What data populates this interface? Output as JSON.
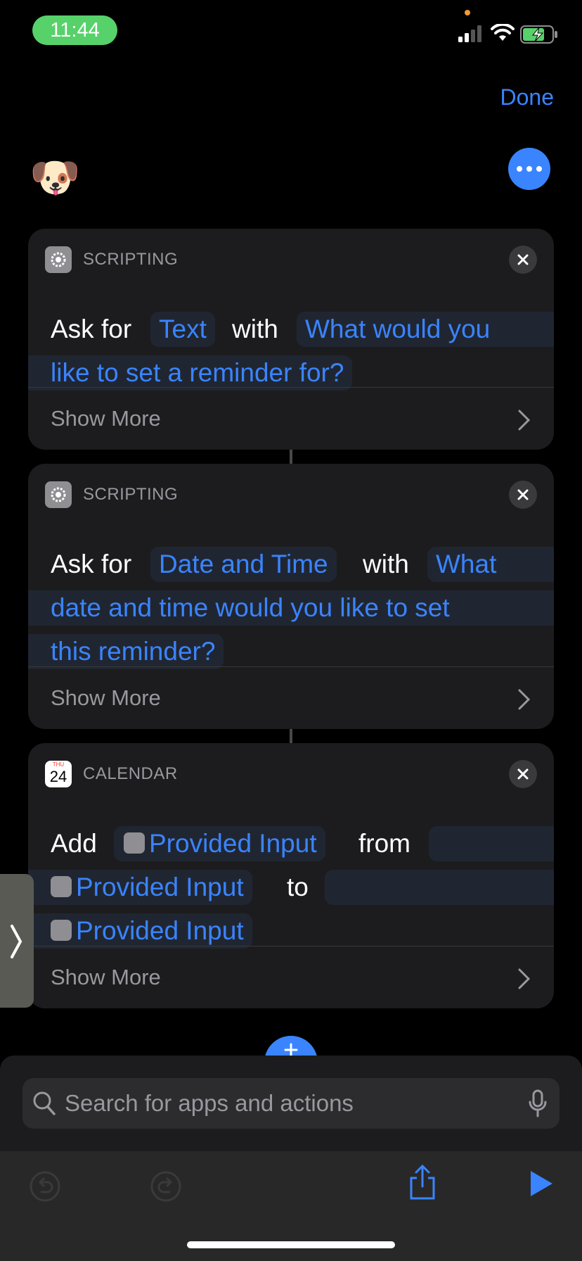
{
  "status_bar": {
    "time": "11:44"
  },
  "header": {
    "done_label": "Done",
    "shortcut_icon": "🐶"
  },
  "actions": [
    {
      "category": "SCRIPTING",
      "verb": "Ask for",
      "type_token": "Text",
      "connector": "with",
      "prompt_line1": "What would you",
      "prompt_line2": "like to set a reminder for?",
      "show_more": "Show More"
    },
    {
      "category": "SCRIPTING",
      "verb": "Ask for",
      "type_token": "Date and Time",
      "connector": "with",
      "prompt_line1": "What",
      "prompt_line2": "date and time would you like to set",
      "prompt_line3": "this reminder?",
      "show_more": "Show More"
    },
    {
      "category": "CALENDAR",
      "calendar_day": "THU",
      "calendar_date": "24",
      "verb": "Add",
      "token1": "Provided Input",
      "word_from": "from",
      "token2": "Provided Input",
      "word_to": "to",
      "token3": "Provided Input",
      "show_more": "Show More"
    }
  ],
  "search": {
    "placeholder": "Search for apps and actions"
  },
  "toolbar": {
    "undo_icon": "undo-icon",
    "redo_icon": "redo-icon",
    "share_icon": "share-icon",
    "run_icon": "play-icon"
  },
  "colors": {
    "accent": "#3a84ff",
    "card": "#1c1c1e",
    "background": "#000000",
    "time_pill": "#57d16a"
  }
}
